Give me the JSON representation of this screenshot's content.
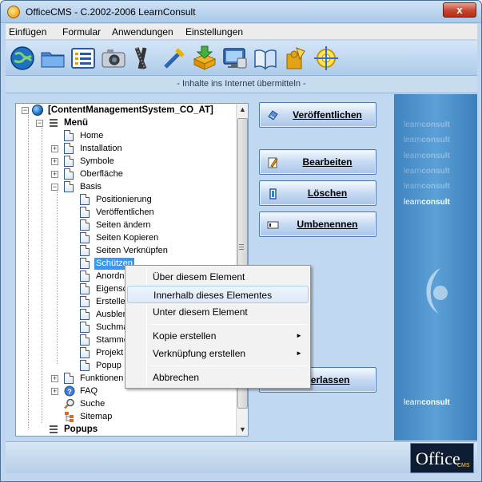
{
  "window": {
    "title": "OfficeCMS - C.2002-2006 LearnConsult",
    "close_label": "x"
  },
  "menubar": {
    "items": [
      "Einfügen",
      "Formular",
      "Anwendungen",
      "Einstellungen"
    ]
  },
  "toolbar": {
    "icons": [
      "globe-icon",
      "folder-icon",
      "list-icon",
      "camera-icon",
      "film-icon",
      "tools-icon",
      "download-icon",
      "screen-icon",
      "book-icon",
      "puzzle-icon",
      "target-icon"
    ]
  },
  "status_line": "- Inhalte ins Internet übermitteln -",
  "tree": {
    "root": "[ContentManagementSystem_CO_AT]",
    "items": [
      {
        "label": "Menü"
      },
      {
        "label": "Home"
      },
      {
        "label": "Installation"
      },
      {
        "label": "Symbole"
      },
      {
        "label": "Oberfläche"
      },
      {
        "label": "Basis"
      },
      {
        "label": "Positionierung"
      },
      {
        "label": "Veröffentlichen"
      },
      {
        "label": "Seiten ändern"
      },
      {
        "label": "Seiten Kopieren"
      },
      {
        "label": "Seiten Verknüpfen"
      },
      {
        "label": "Schützen"
      },
      {
        "label": "Anordne"
      },
      {
        "label": "Eigensc"
      },
      {
        "label": "Erstelle"
      },
      {
        "label": "Ausblen"
      },
      {
        "label": "Suchma"
      },
      {
        "label": "Stammo"
      },
      {
        "label": "Projekt"
      },
      {
        "label": "Popup"
      },
      {
        "label": "Funktionen"
      },
      {
        "label": "FAQ"
      },
      {
        "label": "Suche"
      },
      {
        "label": "Sitemap"
      },
      {
        "label": "Popups"
      }
    ]
  },
  "actions": {
    "publish": "Veröffentlichen",
    "edit": "Bearbeiten",
    "delete": "Löschen",
    "rename": "Umbenennen",
    "leave": "Verlassen"
  },
  "brand": {
    "word_light": "learn",
    "word_bold": "consult"
  },
  "logo": {
    "main": "Office",
    "sub": "CMS"
  },
  "context_menu": {
    "items": [
      {
        "label": "Über diesem Element"
      },
      {
        "label": "Innerhalb dieses Elementes"
      },
      {
        "label": "Unter diesem Element"
      },
      {
        "label": "Kopie erstellen",
        "submenu": "►"
      },
      {
        "label": "Verknüpfung erstellen",
        "submenu": "►"
      },
      {
        "label": "Abbrechen"
      }
    ]
  },
  "colors": {
    "window_bg": "#bfd6ee",
    "selection": "#3399ff",
    "brand_panel": "#4a90cc"
  }
}
